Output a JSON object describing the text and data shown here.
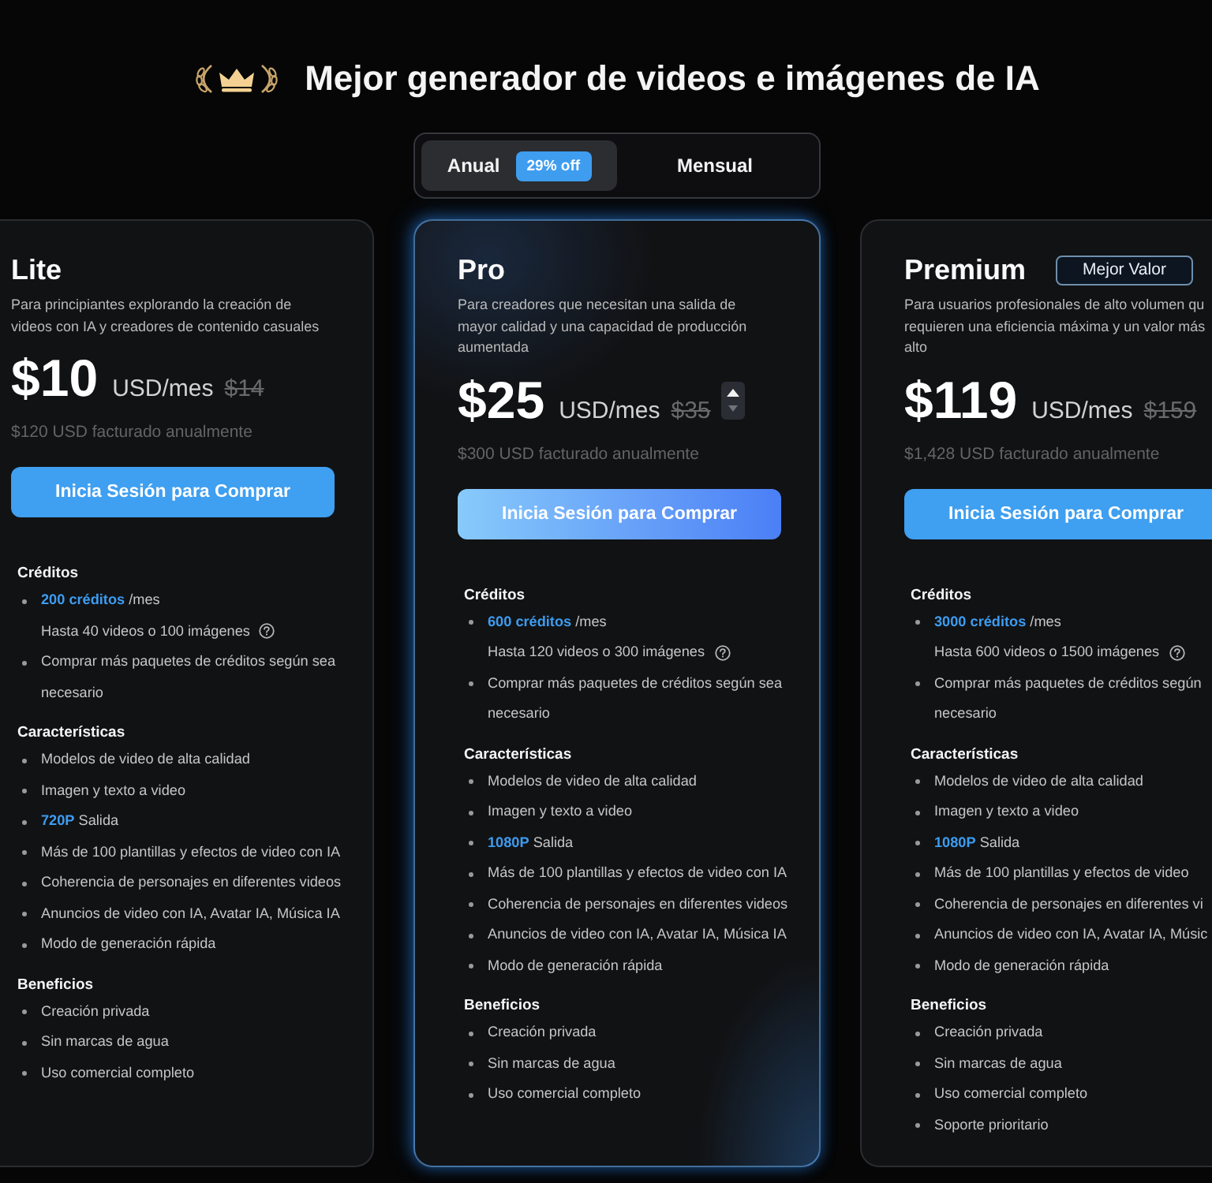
{
  "header": {
    "title": "Mejor generador de videos e imágenes de IA"
  },
  "billing_toggle": {
    "options": [
      {
        "label": "Anual",
        "selected": true,
        "badge": "29% off"
      },
      {
        "label": "Mensual",
        "selected": false
      }
    ]
  },
  "plans": [
    {
      "name": "Lite",
      "featured": false,
      "stepper": false,
      "description": [
        "Para principiantes explorando la creación de",
        "videos con IA y creadores de contenido casuales"
      ],
      "price": "$10",
      "unit": "USD/mes",
      "original_price": "$14",
      "billing": "$120 USD facturado anualmente",
      "button": "Inicia Sesión para Comprar",
      "sections": [
        {
          "heading": "Créditos",
          "items": [
            {
              "text": "**200 créditos** /mes",
              "note": "Hasta 40 videos o 100 imágenes"
            },
            {
              "text": "Comprar más paquetes de créditos según sea necesario"
            }
          ]
        },
        {
          "heading": "Características",
          "items": [
            {
              "text": "Modelos de video de alta calidad"
            },
            {
              "text": "Imagen y texto a video"
            },
            {
              "text": "**720P** Salida"
            },
            {
              "text": "Más de 100 plantillas y efectos de video con IA"
            },
            {
              "text": "Coherencia de personajes en diferentes videos"
            },
            {
              "text": "Anuncios de video con IA, Avatar IA, Música IA"
            },
            {
              "text": "Modo de generación rápida"
            }
          ]
        },
        {
          "heading": "Beneficios",
          "items": [
            {
              "text": "Creación privada"
            },
            {
              "text": "Sin marcas de agua"
            },
            {
              "text": "Uso comercial completo"
            }
          ]
        }
      ]
    },
    {
      "name": "Pro",
      "featured": true,
      "stepper": true,
      "description": [
        "Para creadores que necesitan una salida de",
        "mayor calidad y una capacidad de producción",
        "aumentada"
      ],
      "price": "$25",
      "unit": "USD/mes",
      "original_price": "$35",
      "billing": "$300 USD facturado anualmente",
      "button": "Inicia Sesión para Comprar",
      "sections": [
        {
          "heading": "Créditos",
          "items": [
            {
              "text": "**600 créditos** /mes",
              "note": "Hasta 120 videos o 300 imágenes"
            },
            {
              "text": "Comprar más paquetes de créditos según sea necesario"
            }
          ]
        },
        {
          "heading": "Características",
          "items": [
            {
              "text": "Modelos de video de alta calidad"
            },
            {
              "text": "Imagen y texto a video"
            },
            {
              "text": "**1080P** Salida"
            },
            {
              "text": "Más de 100 plantillas y efectos de video con IA"
            },
            {
              "text": "Coherencia de personajes en diferentes videos"
            },
            {
              "text": "Anuncios de video con IA, Avatar IA, Música IA"
            },
            {
              "text": "Modo de generación rápida"
            }
          ]
        },
        {
          "heading": "Beneficios",
          "items": [
            {
              "text": "Creación privada"
            },
            {
              "text": "Sin marcas de agua"
            },
            {
              "text": "Uso comercial completo"
            }
          ]
        }
      ]
    },
    {
      "name": "Premium",
      "badge": "Mejor Valor",
      "featured": false,
      "stepper": false,
      "description": [
        "Para usuarios profesionales de alto volumen qu",
        "requieren una eficiencia máxima y un valor más",
        "alto"
      ],
      "price": "$119",
      "unit": "USD/mes",
      "original_price": "$159",
      "billing": "$1,428 USD facturado anualmente",
      "button": "Inicia Sesión para Comprar",
      "sections": [
        {
          "heading": "Créditos",
          "items": [
            {
              "text": "**3000 créditos** /mes",
              "note": "Hasta 600 videos o 1500 imágenes"
            },
            {
              "text": "Comprar más paquetes de créditos según necesario"
            }
          ]
        },
        {
          "heading": "Características",
          "items": [
            {
              "text": "Modelos de video de alta calidad"
            },
            {
              "text": "Imagen y texto a video"
            },
            {
              "text": "**1080P** Salida"
            },
            {
              "text": "Más de 100 plantillas y efectos de video"
            },
            {
              "text": "Coherencia de personajes en diferentes vi"
            },
            {
              "text": "Anuncios de video con IA, Avatar IA, Músic"
            },
            {
              "text": "Modo de generación rápida"
            }
          ]
        },
        {
          "heading": "Beneficios",
          "items": [
            {
              "text": "Creación privada"
            },
            {
              "text": "Sin marcas de agua"
            },
            {
              "text": "Uso comercial completo"
            },
            {
              "text": "Soporte prioritario"
            }
          ]
        }
      ]
    }
  ]
}
